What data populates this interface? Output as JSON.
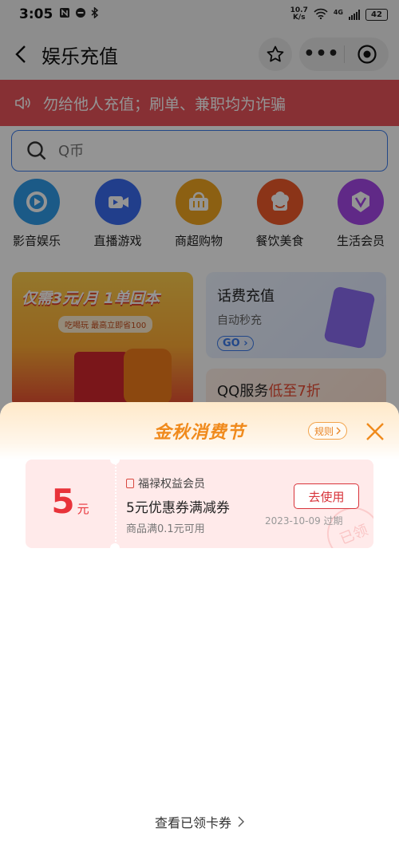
{
  "status_bar": {
    "time": "3:05",
    "net_speed_value": "10.7",
    "net_speed_unit": "K/s",
    "network_type": "4G",
    "battery": "42"
  },
  "nav": {
    "title": "娱乐充值"
  },
  "notice": {
    "text": "勿给他人充值；刷单、兼职均为诈骗"
  },
  "search": {
    "placeholder": "Q币"
  },
  "categories": [
    {
      "label": "影音娱乐",
      "icon": "play-icon",
      "color": "#2f9be9"
    },
    {
      "label": "直播游戏",
      "icon": "video-camera-icon",
      "color": "#3a6cf0"
    },
    {
      "label": "商超购物",
      "icon": "basket-icon",
      "color": "#f2a51f"
    },
    {
      "label": "餐饮美食",
      "icon": "chef-hat-icon",
      "color": "#f05a2a"
    },
    {
      "label": "生活会员",
      "icon": "vip-badge-icon",
      "color": "#a548e8"
    }
  ],
  "promo": {
    "title": "仅需3元/月 1单回本",
    "subtitle": "吃喝玩 最高立即省100"
  },
  "tiles": {
    "recharge_title": "话费充值",
    "recharge_subtitle": "自动秒充",
    "recharge_cta": "GO",
    "qq_title": "QQ服务",
    "qq_highlight": "低至7折"
  },
  "sheet": {
    "title": "金秋消费节",
    "rules_label": "规则",
    "coupon": {
      "amount": "5",
      "unit": "元",
      "brand": "福禄权益会员",
      "name": "5元优惠券满减券",
      "condition": "商品满0.1元可用",
      "use_label": "去使用",
      "expire": "2023-10-09 过期",
      "stamp": "已领"
    },
    "view_link": "查看已领卡券"
  },
  "colors": {
    "accent_red": "#e8333a",
    "notice_red": "#e9545b",
    "title_orange": "#f08a1c",
    "link_blue": "#3b7bea"
  }
}
